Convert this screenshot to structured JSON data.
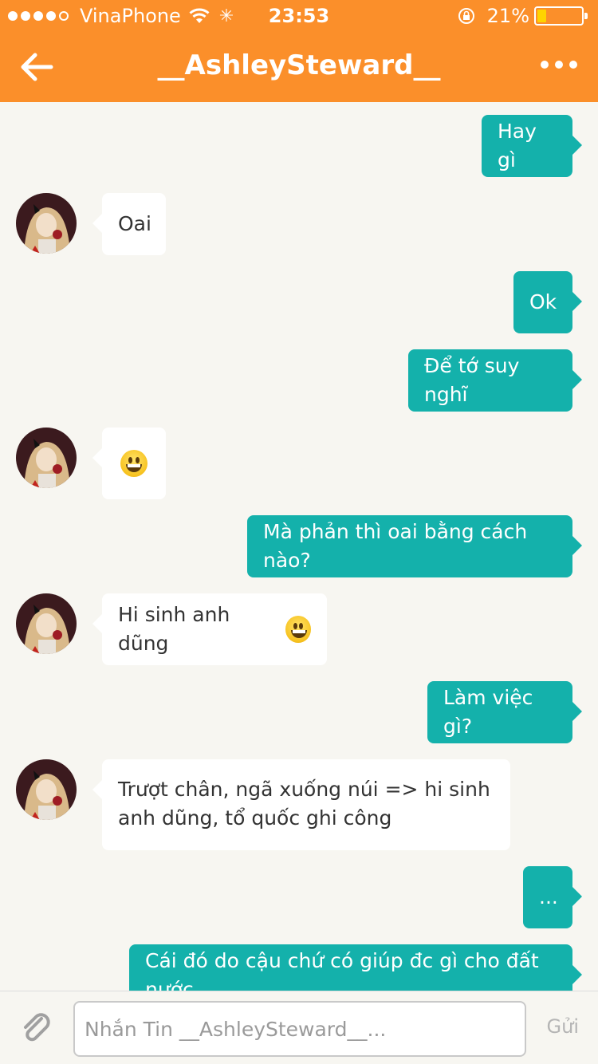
{
  "status_bar": {
    "carrier": "VinaPhone",
    "time": "23:53",
    "battery_percent": "21%",
    "battery_level": 0.21,
    "signal_dots_filled": 4,
    "signal_dots_total": 5,
    "icons": [
      "wifi-icon",
      "activity-spinner-icon",
      "rotation-lock-icon",
      "battery-icon"
    ]
  },
  "header": {
    "title": "__AshleySteward__",
    "back_icon": "arrow-left-icon",
    "more_icon": "more-dots-icon"
  },
  "messages": [
    {
      "direction": "out",
      "text": "Hay gì"
    },
    {
      "direction": "in",
      "text": "Oai"
    },
    {
      "direction": "out",
      "text": "Ok"
    },
    {
      "direction": "out",
      "text": "Để tớ suy nghĩ"
    },
    {
      "direction": "in",
      "text": "",
      "emoji": "grinning-face"
    },
    {
      "direction": "out",
      "text": "Mà phản thì oai bằng cách nào?"
    },
    {
      "direction": "in",
      "text": "Hi sinh anh dũng",
      "emoji": "grinning-face"
    },
    {
      "direction": "out",
      "text": "Làm việc gì?"
    },
    {
      "direction": "in",
      "text": "Trượt chân, ngã xuống núi => hi sinh anh dũng, tổ quốc ghi công"
    },
    {
      "direction": "out",
      "text": "..."
    },
    {
      "direction": "out",
      "text": "Cái đó do cậu chứ có giúp đc gì cho đất nước"
    }
  ],
  "input_bar": {
    "placeholder": "Nhắn Tin __AshleySteward__...",
    "value": "",
    "send_label": "Gửi",
    "attach_icon": "paperclip-icon"
  },
  "colors": {
    "header_bg": "#fb8f2a",
    "outgoing_bubble": "#14b1ab",
    "incoming_bubble": "#ffffff",
    "chat_bg": "#f7f6f1"
  }
}
